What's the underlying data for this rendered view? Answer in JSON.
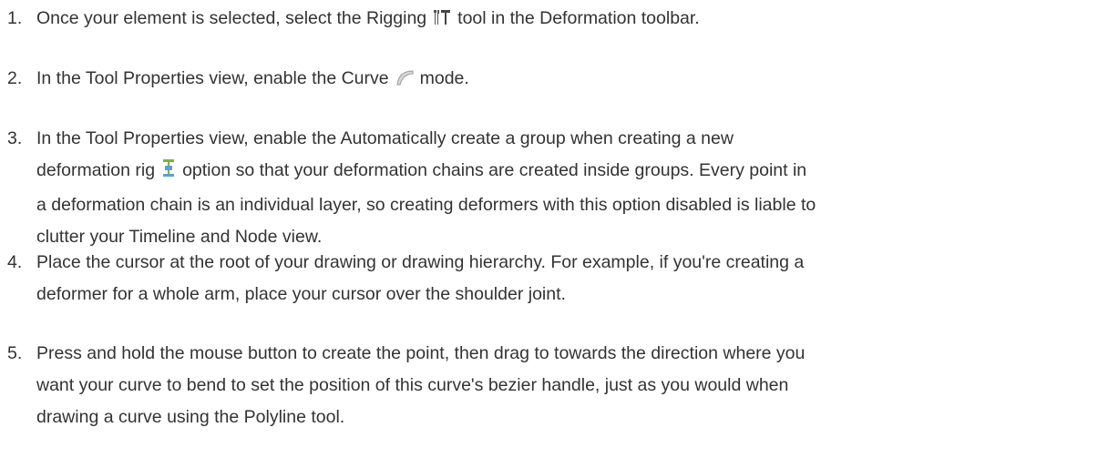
{
  "steps": [
    {
      "number": "1.",
      "before": "Once your element is selected, select the Rigging",
      "icon": "rigging-tool-icon",
      "after": "tool in the Deformation toolbar."
    },
    {
      "number": "2.",
      "before": "In the Tool Properties view, enable the Curve",
      "icon": "curve-mode-icon",
      "after": "mode."
    },
    {
      "number": "3.",
      "line1": "In the Tool Properties view, enable the Automatically create a group when creating a new",
      "before": "deformation rig",
      "icon": "create-group-icon",
      "after": "option so that your deformation chains are created inside groups. Every point in",
      "line3": "a deformation chain is an individual layer, so creating deformers with this option disabled is liable to",
      "line4": "clutter your Timeline and Node view."
    },
    {
      "number": "4.",
      "line1": "Place the cursor at the root of your drawing or drawing hierarchy. For example, if you're creating a",
      "line2": "deformer for a whole arm, place your cursor over the shoulder joint."
    },
    {
      "number": "5.",
      "line1": "Press and hold the mouse button to create the point, then drag to towards the direction where you",
      "line2": "want your curve to bend to set the position of this curve's bezier handle, just as you would when",
      "line3": "drawing a curve using the Polyline tool."
    }
  ]
}
